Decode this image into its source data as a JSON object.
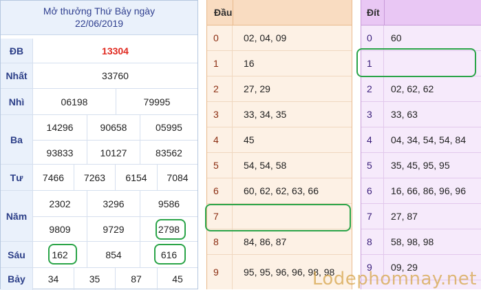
{
  "results": {
    "title_line1": "Mở thưởng Thứ Bảy ngày",
    "title_line2": "22/06/2019",
    "db": {
      "label": "ĐB",
      "values": [
        "13304"
      ]
    },
    "nhat": {
      "label": "Nhất",
      "values": [
        "33760"
      ]
    },
    "nhi": {
      "label": "Nhì",
      "values": [
        "06198",
        "79995"
      ]
    },
    "ba": {
      "label": "Ba",
      "values": [
        "14296",
        "90658",
        "05995",
        "93833",
        "10127",
        "83562"
      ]
    },
    "tu": {
      "label": "Tư",
      "values": [
        "7466",
        "7263",
        "6154",
        "7084"
      ]
    },
    "nam": {
      "label": "Năm",
      "values": [
        "2302",
        "3296",
        "9586",
        "9809",
        "9729",
        "2798"
      ]
    },
    "sau": {
      "label": "Sáu",
      "values": [
        "162",
        "854",
        "616"
      ]
    },
    "bay": {
      "label": "Bảy",
      "values": [
        "34",
        "35",
        "87",
        "45"
      ]
    },
    "highlight_color": "#2aa448",
    "db_color": "#e0281e"
  },
  "dau": {
    "header": "Đầu",
    "rows": [
      {
        "k": "0",
        "v": "02, 04, 09"
      },
      {
        "k": "1",
        "v": "16"
      },
      {
        "k": "2",
        "v": "27, 29"
      },
      {
        "k": "3",
        "v": "33, 34, 35"
      },
      {
        "k": "4",
        "v": "45"
      },
      {
        "k": "5",
        "v": "54, 54, 58"
      },
      {
        "k": "6",
        "v": "60, 62, 62, 63, 66"
      },
      {
        "k": "7",
        "v": ""
      },
      {
        "k": "8",
        "v": "84, 86, 87"
      },
      {
        "k": "9",
        "v": "95, 95, 96, 96, 98, 98"
      }
    ]
  },
  "dit": {
    "header": "Đít",
    "rows": [
      {
        "k": "0",
        "v": "60"
      },
      {
        "k": "1",
        "v": ""
      },
      {
        "k": "2",
        "v": "02, 62, 62"
      },
      {
        "k": "3",
        "v": "33, 63"
      },
      {
        "k": "4",
        "v": "04, 34, 54, 54, 84"
      },
      {
        "k": "5",
        "v": "35, 45, 95, 95"
      },
      {
        "k": "6",
        "v": "16, 66, 86, 96, 96"
      },
      {
        "k": "7",
        "v": "27, 87"
      },
      {
        "k": "8",
        "v": "58, 98, 98"
      },
      {
        "k": "9",
        "v": "09, 29"
      }
    ]
  },
  "watermark": "Lodephomnay.net"
}
